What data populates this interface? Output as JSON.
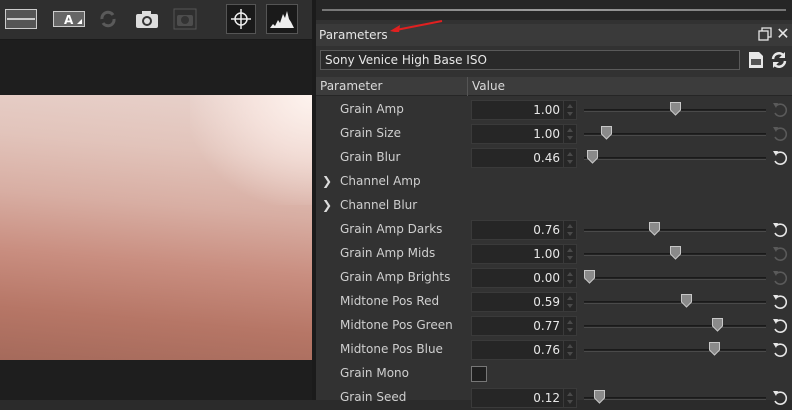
{
  "panel": {
    "title": "Parameters",
    "preset": "Sony Venice High Base ISO"
  },
  "columns": {
    "parameter": "Parameter",
    "value": "Value"
  },
  "toolbar_icons": [
    "filmstrip-icon",
    "text-overlay-icon",
    "sync-icon",
    "camera-icon",
    "camera-disabled-icon",
    "crosshair-icon",
    "histogram-icon"
  ],
  "colors": {
    "accent_arrow": "#e02020",
    "panel_bg": "#323232",
    "field_bg": "#262626"
  },
  "params": [
    {
      "label": "Grain Amp",
      "value": "1.00",
      "level": 0.5,
      "reset_active": false
    },
    {
      "label": "Grain Size",
      "value": "1.00",
      "level": 0.1,
      "reset_active": false
    },
    {
      "label": "Grain Blur",
      "value": "0.46",
      "level": 0.02,
      "reset_active": true
    },
    {
      "label": "Channel Amp",
      "group": true
    },
    {
      "label": "Channel Blur",
      "group": true
    },
    {
      "label": "Grain Amp Darks",
      "value": "0.76",
      "level": 0.38,
      "reset_active": true
    },
    {
      "label": "Grain Amp Mids",
      "value": "1.00",
      "level": 0.5,
      "reset_active": false
    },
    {
      "label": "Grain Amp Brights",
      "value": "0.00",
      "level": 0.0,
      "reset_active": false
    },
    {
      "label": "Midtone Pos Red",
      "value": "0.59",
      "level": 0.57,
      "reset_active": true
    },
    {
      "label": "Midtone Pos Green",
      "value": "0.77",
      "level": 0.75,
      "reset_active": true
    },
    {
      "label": "Midtone Pos Blue",
      "value": "0.76",
      "level": 0.73,
      "reset_active": true
    },
    {
      "label": "Grain Mono",
      "checkbox": true
    },
    {
      "label": "Grain Seed",
      "value": "0.12",
      "level": 0.06,
      "reset_active": true
    }
  ]
}
